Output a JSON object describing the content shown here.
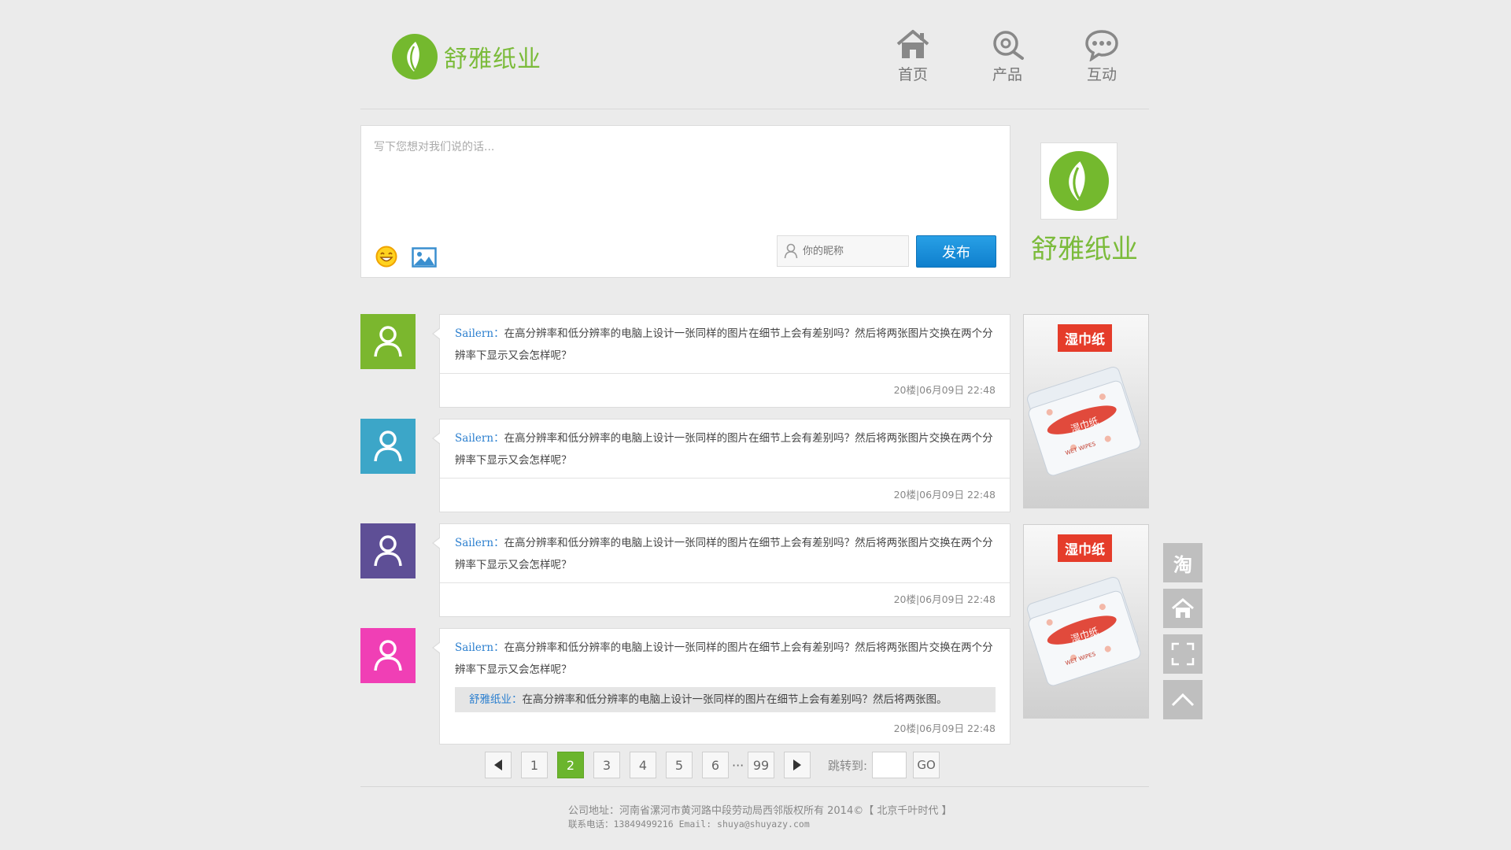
{
  "brand": {
    "name": "舒雅纸业",
    "accent": "#74b92e"
  },
  "nav": [
    {
      "label": "首页",
      "icon": "home-icon"
    },
    {
      "label": "产品",
      "icon": "search-icon"
    },
    {
      "label": "互动",
      "icon": "chat-icon"
    }
  ],
  "compose": {
    "placeholder": "写下您想对我们说的话...",
    "nickname_placeholder": "你的昵称",
    "publish_label": "发布",
    "emoji_icon": "emoji-icon",
    "image_icon": "image-icon"
  },
  "comments": [
    {
      "user": "Sailern：",
      "text": "在高分辨率和低分辨率的电脑上设计一张同样的图片在细节上会有差别吗？然后将两张图片交换在两个分辨率下显示又会怎样呢？",
      "meta": "20楼|06月09日  22:48",
      "avatar_color": "#7bb72e"
    },
    {
      "user": "Sailern：",
      "text": "在高分辨率和低分辨率的电脑上设计一张同样的图片在细节上会有差别吗？然后将两张图片交换在两个分辨率下显示又会怎样呢？",
      "meta": "20楼|06月09日  22:48",
      "avatar_color": "#3ca6c8"
    },
    {
      "user": "Sailern：",
      "text": "在高分辨率和低分辨率的电脑上设计一张同样的图片在细节上会有差别吗？然后将两张图片交换在两个分辨率下显示又会怎样呢？",
      "meta": "20楼|06月09日  22:48",
      "avatar_color": "#5e4f96"
    },
    {
      "user": "Sailern：",
      "text": "在高分辨率和低分辨率的电脑上设计一张同样的图片在细节上会有差别吗？然后将两张图片交换在两个分辨率下显示又会怎样呢？",
      "reply_user": "舒雅纸业：",
      "reply_text": "在高分辨率和低分辨率的电脑上设计一张同样的图片在细节上会有差别吗？然后将两张图。",
      "meta": "20楼|06月09日  22:48",
      "avatar_color": "#f03fb5"
    }
  ],
  "ads": [
    {
      "tag": "湿巾纸",
      "product_text": "湿巾纸",
      "product_sub": "WET WIPES"
    },
    {
      "tag": "湿巾纸",
      "product_text": "湿巾纸",
      "product_sub": "WET WIPES"
    }
  ],
  "pagination": {
    "pages": [
      "1",
      "2",
      "3",
      "4",
      "5",
      "6"
    ],
    "current": "2",
    "ellipsis": "···",
    "last": "99",
    "jump_label": "跳转到:",
    "go_label": "GO"
  },
  "footer": {
    "line1": "公司地址：河南省漯河市黄河路中段劳动局西邻版权所有 2014©【 北京千叶时代 】",
    "line2": "联系电话：13849499216 Email: shuya@shuyazy.com"
  },
  "float_bar": [
    {
      "label": "淘",
      "icon": "taobao-icon"
    },
    {
      "label": "",
      "icon": "home-icon"
    },
    {
      "label": "",
      "icon": "fullscreen-icon"
    },
    {
      "label": "",
      "icon": "chevron-up-icon"
    }
  ]
}
